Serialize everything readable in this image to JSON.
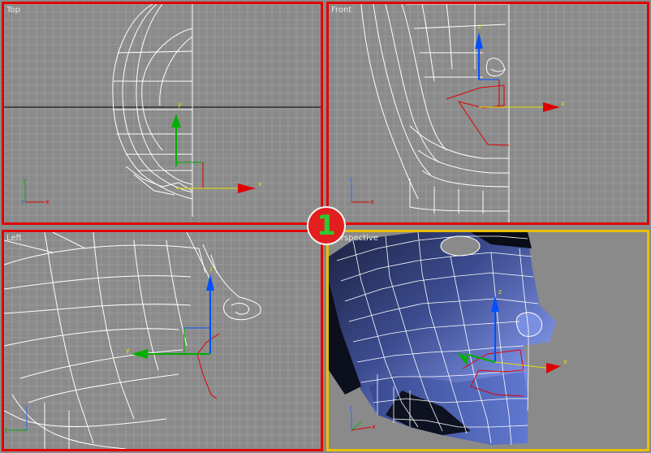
{
  "viewports": [
    {
      "id": "top",
      "label": "Top",
      "active": false
    },
    {
      "id": "front",
      "label": "Front",
      "active": false
    },
    {
      "id": "left",
      "label": "Left",
      "active": false
    },
    {
      "id": "perspective",
      "label": "Perspective",
      "active": true
    }
  ],
  "axis_labels": {
    "x": "x",
    "y": "y",
    "z": "z"
  },
  "badge": {
    "text": "1"
  },
  "colors": {
    "viewport_bg": "#8a8a8a",
    "grid": "#9a9a9a",
    "wire": "#ffffff",
    "viewport_border": "#e00000",
    "active_border": "#e8c000",
    "axis_x": "#e00000",
    "axis_y": "#00b000",
    "axis_z": "#0050ff",
    "mesh_blue": "#4a5aa0",
    "badge_bg": "#e21e1e",
    "badge_text": "#2fc92f"
  }
}
